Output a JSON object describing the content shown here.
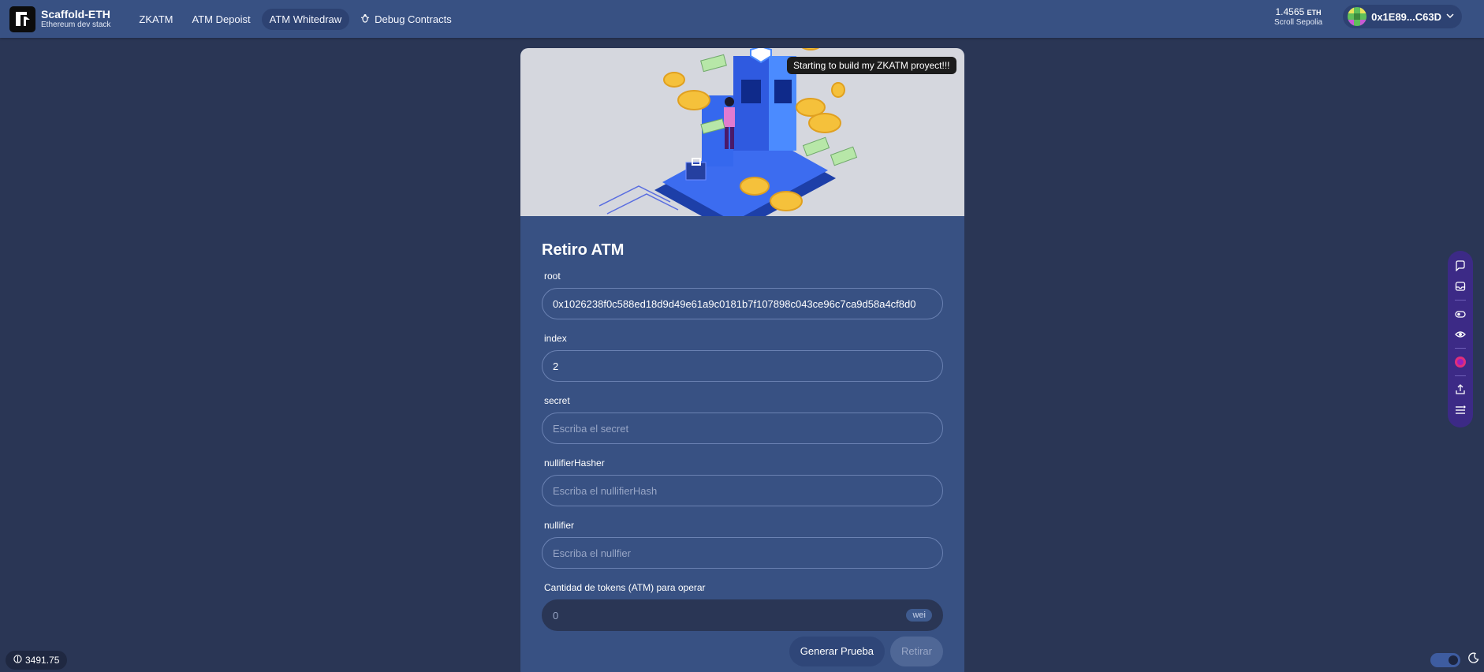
{
  "header": {
    "brand_title": "Scaffold-ETH",
    "brand_subtitle": "Ethereum dev stack",
    "nav": [
      {
        "label": "ZKATM",
        "active": false
      },
      {
        "label": "ATM Depoist",
        "active": false
      },
      {
        "label": "ATM Whitedraw",
        "active": true
      },
      {
        "label": "Debug Contracts",
        "active": false,
        "icon": "bug-icon"
      }
    ],
    "balance_value": "1.4565",
    "balance_unit": "ETH",
    "network": "Scroll Sepolia",
    "address": "0x1E89...C63D"
  },
  "hero": {
    "tooltip": "Starting to build my ZKATM proyect!!!"
  },
  "form": {
    "title": "Retiro ATM",
    "fields": [
      {
        "label": "root",
        "value": "0x1026238f0c588ed18d9d49e61a9c0181b7f107898c043ce96c7ca9d58a4cf8d0",
        "placeholder": ""
      },
      {
        "label": "index",
        "value": "2",
        "placeholder": ""
      },
      {
        "label": "secret",
        "value": "",
        "placeholder": "Escriba el secret"
      },
      {
        "label": "nullifierHasher",
        "value": "",
        "placeholder": "Escriba el nullifierHash"
      },
      {
        "label": "nullifier",
        "value": "",
        "placeholder": "Escriba el nullfier"
      }
    ],
    "amount_label": "Cantidad de tokens (ATM) para operar",
    "amount_placeholder": "0",
    "amount_unit": "wei",
    "generate_button": "Generar Prueba",
    "withdraw_button": "Retirar"
  },
  "footer": {
    "eth_price": "3491.75"
  },
  "colors": {
    "background": "#2a3655",
    "header": "#385183",
    "card": "#385183",
    "toolbar": "#3c2a86"
  },
  "toolbar_icons": [
    "chat-icon",
    "inbox-icon",
    "toggle-icon",
    "eye-icon",
    "avatar-icon",
    "share-icon",
    "menu-icon"
  ]
}
